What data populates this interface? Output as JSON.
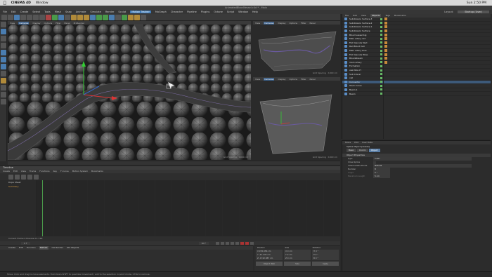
{
  "macbar": {
    "app": "CINEMA 4D",
    "menu": "Window",
    "clock": "Sun 2:50 PM"
  },
  "window_title": "AnimatedBloodVessel.c4d * - Main",
  "menubar": {
    "items": [
      "File",
      "Edit",
      "Create",
      "Select",
      "Tools",
      "Mesh",
      "Snap",
      "Animate",
      "Simulate",
      "Render",
      "Sculpt",
      "Motion Tracker",
      "MoGraph",
      "Character",
      "Pipeline",
      "Plugins",
      "Octane",
      "Script",
      "Window",
      "Help"
    ],
    "highlight": "Motion Tracker",
    "layout_label": "Layout:",
    "layout_value": "Startup (User)"
  },
  "viewports": {
    "main_tabs": [
      "View",
      "Cameras",
      "Display",
      "Options",
      "Filter",
      "Panel",
      "ProRender"
    ],
    "main_label": "Perspective",
    "main_grid": "Grid Spacing : 1000 cm",
    "top_right_tabs": [
      "View",
      "Cameras",
      "Display",
      "Options",
      "Filter",
      "Panel"
    ],
    "top_right_label": "Top",
    "top_right_grid": "Grid Spacing : 1000 cm",
    "bottom_right_tabs": [
      "View",
      "Cameras",
      "Display",
      "Options",
      "Filter",
      "Panel"
    ],
    "bottom_right_label": "Right",
    "bottom_right_grid": "Grid Spacing : 1000 cm"
  },
  "timeline": {
    "header": "Timeline",
    "menu": [
      "Create",
      "Edit",
      "View",
      "Frame",
      "Functions",
      "Key",
      "F-Curve",
      "Motion System",
      "Bookmarks"
    ],
    "rows": [
      "Dope Sheet",
      "Summary"
    ],
    "status": "Current Frame  0  Preview  0-->90"
  },
  "playback": {
    "start": "0 F",
    "end": "90 F"
  },
  "material_manager": {
    "menu": [
      "Create",
      "Edit",
      "Function",
      "Texture",
      "Cel Render",
      "Old Objects"
    ],
    "active": "Texture"
  },
  "coordinates": {
    "headers": [
      "Position",
      "Size",
      "Rotation"
    ],
    "rows": [
      [
        "X  976.956 cm",
        "X  0 cm",
        "H  0 °"
      ],
      [
        "Y  -41.145 cm",
        "Y  0 cm",
        "P  0 °"
      ],
      [
        "Z  -1742.887 cm",
        "Z  0 cm",
        "B  0 °"
      ]
    ],
    "buttons": [
      "Object (Rel)",
      "Size",
      "Apply"
    ]
  },
  "object_manager": {
    "tabs": [
      "File",
      "Edit",
      "View",
      "Objects",
      "Tags",
      "Bookmarks"
    ],
    "active_tab": "Objects",
    "objects": [
      "Subdivision Surface.3",
      "Subdivision Surface.2",
      "Subdivision Surface.1",
      "Subdivision Surface",
      "Blood vessel big",
      "Main artery red",
      "Full Vascular Red",
      "Red Blood Cell",
      "Main artery blue",
      "Full Vascular Blue",
      "Bloodstream",
      "main artery",
      "Formation",
      "vein Non-H",
      "Sub Cloner",
      "cell",
      "Connector",
      "Track Curve",
      "Beam.1",
      "Beam"
    ],
    "selected_index": 16
  },
  "attributes": {
    "menu": [
      "Mode",
      "Edit",
      "User Data"
    ],
    "title": "Spline Object [vessel]",
    "tabs": [
      "Basic",
      "Coord.",
      "Object"
    ],
    "active_tab": "Object",
    "section": "Object Properties",
    "props": [
      {
        "label": "Type",
        "value": "Cubic"
      },
      {
        "label": "Close Spline",
        "value": ""
      },
      {
        "label": "Intermediate Points",
        "value": "Natural"
      },
      {
        "label": "Number",
        "value": "8"
      },
      {
        "label": "Angle",
        "value": "5 °"
      },
      {
        "label": "Maximum Length",
        "value": "5 cm"
      }
    ]
  },
  "statusbar": "Move: Click and drag to move elements. Hold down SHIFT to quantize movement / add to the selection in point mode, CTRL to remove."
}
